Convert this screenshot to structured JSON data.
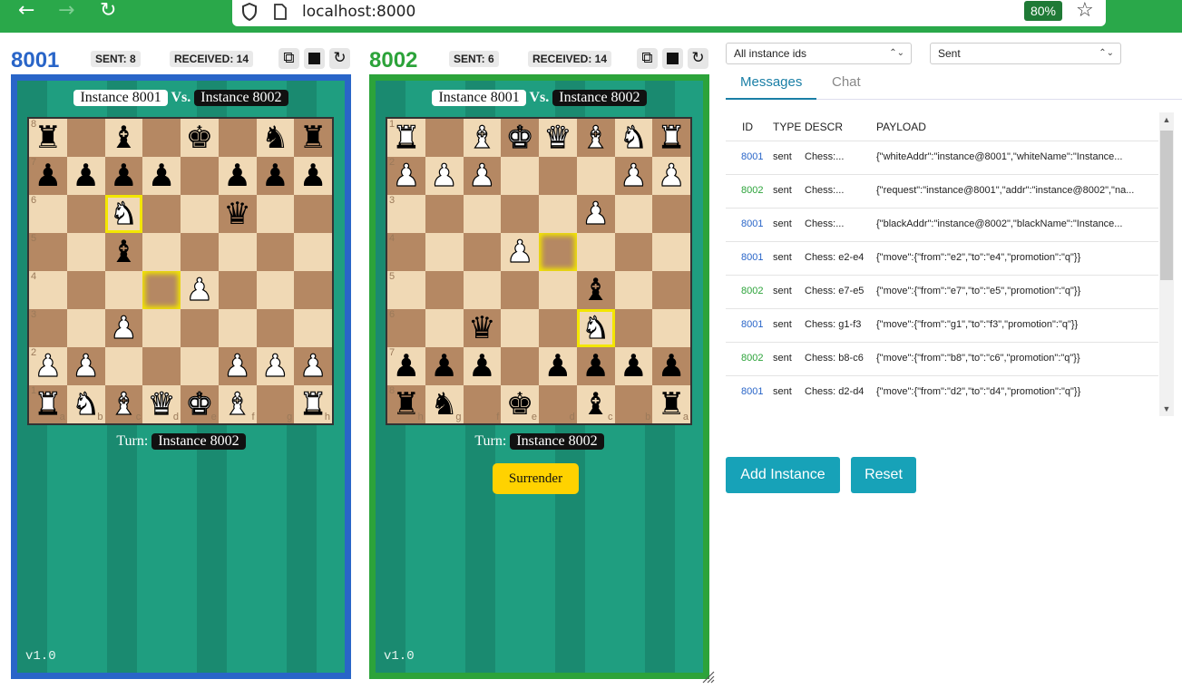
{
  "browser": {
    "url": "localhost:8000",
    "zoom": "80%"
  },
  "instances": [
    {
      "port": "8001",
      "color": "#2965c8",
      "sent": "SENT: 8",
      "received": "RECEIVED: 14",
      "white_name": "Instance 8001",
      "vs": "Vs.",
      "black_name": "Instance 8002",
      "turn_label": "Turn:",
      "turn_name": "Instance 8002",
      "version": "v1.0",
      "board": [
        [
          "bR",
          "",
          "bB",
          "",
          "bK",
          "",
          "bN",
          "bR"
        ],
        [
          "bP",
          "bP",
          "bP",
          "bP",
          "",
          "bP",
          "bP",
          "bP"
        ],
        [
          "",
          "",
          "wN",
          "",
          "",
          "bQ",
          "",
          ""
        ],
        [
          "",
          "",
          "bB",
          "",
          "",
          "",
          "",
          ""
        ],
        [
          "",
          "",
          "",
          "",
          "wP",
          "",
          "",
          ""
        ],
        [
          "",
          "",
          "wP",
          "",
          "",
          "",
          "",
          ""
        ],
        [
          "wP",
          "wP",
          "",
          "",
          "",
          "wP",
          "wP",
          "wP"
        ],
        [
          "wR",
          "wN",
          "wB",
          "wQ",
          "wK",
          "wB",
          "",
          "wR"
        ]
      ],
      "ranks": [
        "8",
        "7",
        "6",
        "5",
        "4",
        "3",
        "2",
        "1"
      ],
      "files": [
        "a",
        "b",
        "c",
        "d",
        "e",
        "f",
        "g",
        "h"
      ],
      "highlight": [
        2,
        2
      ],
      "target": [
        4,
        3
      ]
    },
    {
      "port": "8002",
      "color": "#2ca33a",
      "sent": "SENT: 6",
      "received": "RECEIVED: 14",
      "white_name": "Instance 8001",
      "vs": "Vs.",
      "black_name": "Instance 8002",
      "turn_label": "Turn:",
      "turn_name": "Instance 8002",
      "surrender": "Surrender",
      "version": "v1.0",
      "board": [
        [
          "wR",
          "",
          "wB",
          "wK",
          "wQ",
          "wB",
          "wN",
          "wR"
        ],
        [
          "wP",
          "wP",
          "wP",
          "",
          "",
          "",
          "wP",
          "wP"
        ],
        [
          "",
          "",
          "",
          "",
          "",
          "wP",
          "",
          ""
        ],
        [
          "",
          "",
          "",
          "wP",
          "",
          "",
          "",
          ""
        ],
        [
          "",
          "",
          "",
          "",
          "",
          "bB",
          "",
          ""
        ],
        [
          "",
          "",
          "bQ",
          "",
          "",
          "wN",
          "",
          ""
        ],
        [
          "bP",
          "bP",
          "bP",
          "",
          "bP",
          "bP",
          "bP",
          "bP"
        ],
        [
          "bR",
          "bN",
          "",
          "bK",
          "",
          "bB",
          "",
          "bR"
        ]
      ],
      "ranks": [
        "1",
        "2",
        "3",
        "4",
        "5",
        "6",
        "7",
        "8"
      ],
      "files": [
        "h",
        "g",
        "f",
        "e",
        "d",
        "c",
        "b",
        "a"
      ],
      "highlight": [
        5,
        5
      ],
      "target": [
        3,
        4
      ]
    }
  ],
  "filters": {
    "instance": "All instance ids",
    "type": "Sent"
  },
  "tabs": [
    "Messages",
    "Chat"
  ],
  "table": {
    "headers": [
      "ID",
      "TYPE",
      "DESCR",
      "PAYLOAD"
    ],
    "rows": [
      {
        "id": "8001",
        "type": "sent",
        "descr": "Chess:...",
        "payload": "{\"whiteAddr\":\"instance@8001\",\"whiteName\":\"Instance..."
      },
      {
        "id": "8002",
        "type": "sent",
        "descr": "Chess:...",
        "payload": "{\"request\":\"instance@8001\",\"addr\":\"instance@8002\",\"na..."
      },
      {
        "id": "8001",
        "type": "sent",
        "descr": "Chess:...",
        "payload": "{\"blackAddr\":\"instance@8002\",\"blackName\":\"Instance..."
      },
      {
        "id": "8001",
        "type": "sent",
        "descr": "Chess: e2-e4",
        "payload": "{\"move\":{\"from\":\"e2\",\"to\":\"e4\",\"promotion\":\"q\"}}"
      },
      {
        "id": "8002",
        "type": "sent",
        "descr": "Chess: e7-e5",
        "payload": "{\"move\":{\"from\":\"e7\",\"to\":\"e5\",\"promotion\":\"q\"}}"
      },
      {
        "id": "8001",
        "type": "sent",
        "descr": "Chess: g1-f3",
        "payload": "{\"move\":{\"from\":\"g1\",\"to\":\"f3\",\"promotion\":\"q\"}}"
      },
      {
        "id": "8002",
        "type": "sent",
        "descr": "Chess: b8-c6",
        "payload": "{\"move\":{\"from\":\"b8\",\"to\":\"c6\",\"promotion\":\"q\"}}"
      },
      {
        "id": "8001",
        "type": "sent",
        "descr": "Chess: d2-d4",
        "payload": "{\"move\":{\"from\":\"d2\",\"to\":\"d4\",\"promotion\":\"q\"}}"
      }
    ]
  },
  "buttons": {
    "add": "Add Instance",
    "reset": "Reset"
  },
  "colors": {
    "id8001": "#2965c8",
    "id8002": "#2ca33a",
    "accent": "#17a2b8"
  }
}
